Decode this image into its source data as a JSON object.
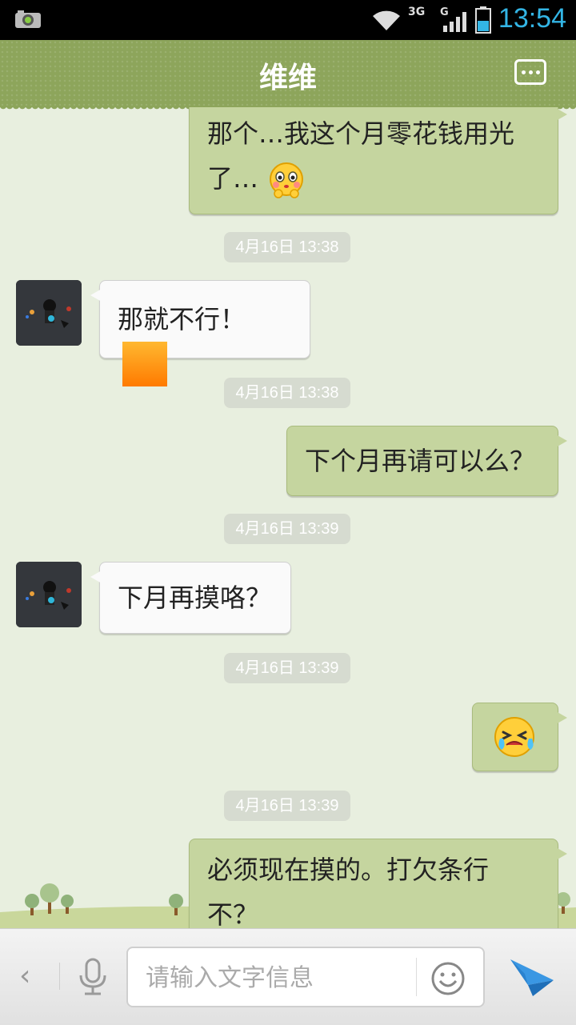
{
  "status_bar": {
    "network_label": "3G",
    "signal_label": "G",
    "time": "13:54"
  },
  "header": {
    "title": "维维"
  },
  "messages": [
    {
      "type": "out",
      "text_line1": "那个…我这个月零花钱用光",
      "text_line2": "了…",
      "emoji": "worried-face-emoji"
    },
    {
      "type": "timestamp",
      "text": "4月16日 13:38"
    },
    {
      "type": "in",
      "text": "那就不行！",
      "emoji": "orange-square-emoji"
    },
    {
      "type": "timestamp",
      "text": "4月16日 13:38"
    },
    {
      "type": "out",
      "text": "下个月再请可以么？"
    },
    {
      "type": "timestamp",
      "text": "4月16日 13:39"
    },
    {
      "type": "in",
      "text": "下月再摸咯？"
    },
    {
      "type": "timestamp",
      "text": "4月16日 13:39"
    },
    {
      "type": "out",
      "emoji": "crying-face-emoji"
    },
    {
      "type": "timestamp",
      "text": "4月16日 13:39"
    },
    {
      "type": "out",
      "text_line1": "必须现在摸的。打欠条行",
      "text_line2": "不？"
    }
  ],
  "input_bar": {
    "back_glyph": "‹",
    "placeholder": "请输入文字信息"
  },
  "colors": {
    "header_green": "#8da55b",
    "outgoing_bubble": "#c5d59f",
    "incoming_bubble": "#fafafa",
    "chat_background": "#e8efdf",
    "status_time": "#33b5e5",
    "send_icon": "#2e8bd6"
  }
}
